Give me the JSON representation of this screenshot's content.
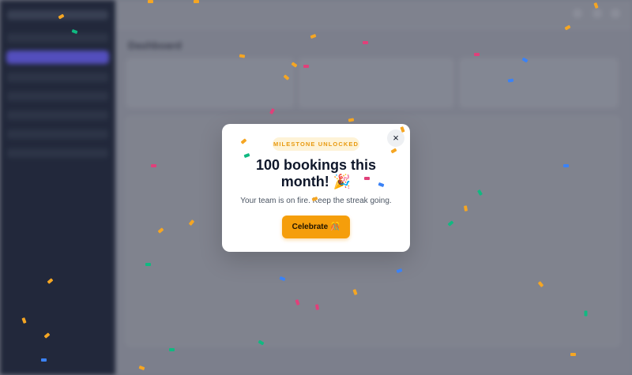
{
  "background": {
    "page_title": "Dashboard"
  },
  "modal": {
    "badge": "MILESTONE UNLOCKED",
    "title": "100 bookings this month! 🎉",
    "subtitle": "Your team is on fire. Keep the streak going.",
    "cta_label": "Celebrate 🎊",
    "close_label": "×",
    "accent_color": "#f59e0b"
  },
  "confetti_colors": [
    "#f5a623",
    "#e0407a",
    "#10b981",
    "#3b82f6"
  ]
}
